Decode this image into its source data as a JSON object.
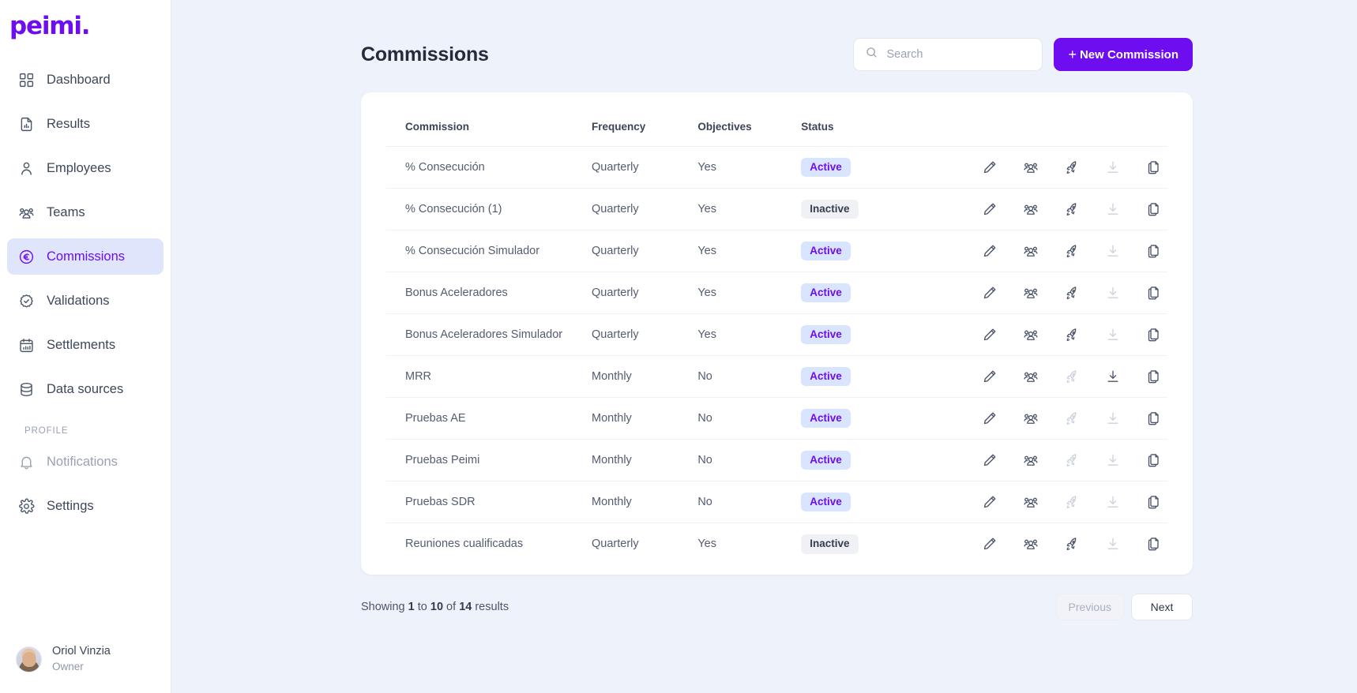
{
  "brand": {
    "logo": "peimi."
  },
  "sidebar": {
    "items": [
      {
        "label": "Dashboard",
        "icon": "grid-icon",
        "state": "default"
      },
      {
        "label": "Results",
        "icon": "document-chart-icon",
        "state": "default"
      },
      {
        "label": "Employees",
        "icon": "user-icon",
        "state": "default"
      },
      {
        "label": "Teams",
        "icon": "users-group-icon",
        "state": "default"
      },
      {
        "label": "Commissions",
        "icon": "euro-circle-icon",
        "state": "active"
      },
      {
        "label": "Validations",
        "icon": "check-badge-icon",
        "state": "default"
      },
      {
        "label": "Settlements",
        "icon": "calendar-icon",
        "state": "default"
      },
      {
        "label": "Data sources",
        "icon": "database-icon",
        "state": "default"
      }
    ],
    "section_label": "PROFILE",
    "profile_items": [
      {
        "label": "Notifications",
        "icon": "bell-icon",
        "state": "muted"
      },
      {
        "label": "Settings",
        "icon": "gear-icon",
        "state": "default"
      }
    ],
    "user": {
      "name": "Oriol Vinzia",
      "role": "Owner"
    }
  },
  "header": {
    "title": "Commissions",
    "search": {
      "placeholder": "Search",
      "value": "",
      "icon": "search-icon"
    },
    "new_button": {
      "plus": "+",
      "label": "New Commission"
    }
  },
  "table": {
    "columns": [
      "Commission",
      "Frequency",
      "Objectives",
      "Status",
      ""
    ],
    "rows": [
      {
        "commission": "% Consecución",
        "frequency": "Quarterly",
        "objectives": "Yes",
        "status": "Active",
        "actions": {
          "edit": "enabled",
          "assign": "enabled",
          "launch": "enabled",
          "download": "disabled",
          "duplicate": "enabled"
        }
      },
      {
        "commission": "% Consecución (1)",
        "frequency": "Quarterly",
        "objectives": "Yes",
        "status": "Inactive",
        "actions": {
          "edit": "enabled",
          "assign": "enabled",
          "launch": "enabled",
          "download": "disabled",
          "duplicate": "enabled"
        }
      },
      {
        "commission": "% Consecución Simulador",
        "frequency": "Quarterly",
        "objectives": "Yes",
        "status": "Active",
        "actions": {
          "edit": "enabled",
          "assign": "enabled",
          "launch": "enabled",
          "download": "disabled",
          "duplicate": "enabled"
        }
      },
      {
        "commission": "Bonus Aceleradores",
        "frequency": "Quarterly",
        "objectives": "Yes",
        "status": "Active",
        "actions": {
          "edit": "enabled",
          "assign": "enabled",
          "launch": "enabled",
          "download": "disabled",
          "duplicate": "enabled"
        }
      },
      {
        "commission": "Bonus Aceleradores Simulador",
        "frequency": "Quarterly",
        "objectives": "Yes",
        "status": "Active",
        "actions": {
          "edit": "enabled",
          "assign": "enabled",
          "launch": "enabled",
          "download": "disabled",
          "duplicate": "enabled"
        }
      },
      {
        "commission": "MRR",
        "frequency": "Monthly",
        "objectives": "No",
        "status": "Active",
        "actions": {
          "edit": "enabled",
          "assign": "enabled",
          "launch": "disabled",
          "download": "enabled",
          "duplicate": "enabled"
        }
      },
      {
        "commission": "Pruebas AE",
        "frequency": "Monthly",
        "objectives": "No",
        "status": "Active",
        "actions": {
          "edit": "enabled",
          "assign": "enabled",
          "launch": "disabled",
          "download": "disabled",
          "duplicate": "enabled"
        }
      },
      {
        "commission": "Pruebas Peimi",
        "frequency": "Monthly",
        "objectives": "No",
        "status": "Active",
        "actions": {
          "edit": "enabled",
          "assign": "enabled",
          "launch": "disabled",
          "download": "disabled",
          "duplicate": "enabled"
        }
      },
      {
        "commission": "Pruebas SDR",
        "frequency": "Monthly",
        "objectives": "No",
        "status": "Active",
        "actions": {
          "edit": "enabled",
          "assign": "enabled",
          "launch": "disabled",
          "download": "disabled",
          "duplicate": "enabled"
        }
      },
      {
        "commission": "Reuniones cualificadas",
        "frequency": "Quarterly",
        "objectives": "Yes",
        "status": "Inactive",
        "actions": {
          "edit": "enabled",
          "assign": "enabled",
          "launch": "enabled",
          "download": "disabled",
          "duplicate": "enabled"
        }
      }
    ],
    "action_icons": [
      "pencil-icon",
      "users-group-icon",
      "rocket-icon",
      "download-icon",
      "copy-icon"
    ]
  },
  "footer": {
    "showing_prefix": "Showing ",
    "from": "1",
    "showing_mid1": " to ",
    "to": "10",
    "showing_mid2": " of ",
    "total": "14",
    "showing_suffix": " results",
    "previous_label": "Previous",
    "next_label": "Next"
  },
  "colors": {
    "brand_purple": "#6d0df0",
    "page_bg": "#eef2fb",
    "active_nav_bg": "#dfe6fb",
    "badge_active_bg": "#d9e4ff",
    "badge_inactive_bg": "#f0f1f5"
  }
}
